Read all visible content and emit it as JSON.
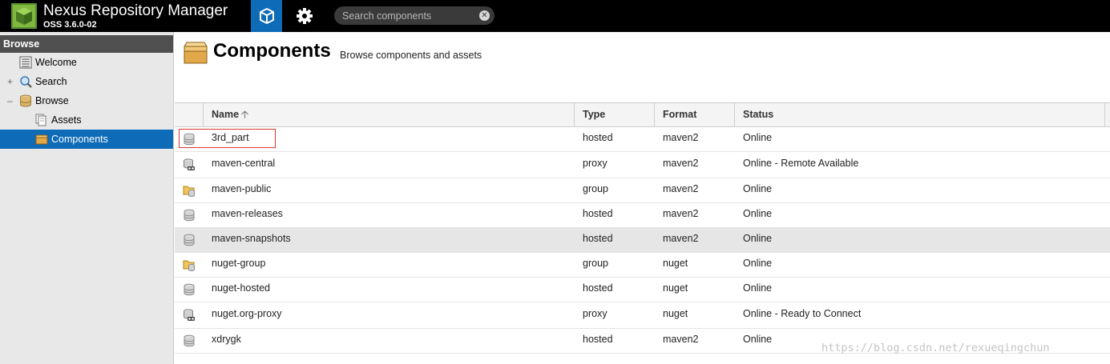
{
  "app": {
    "title": "Nexus Repository Manager",
    "version": "OSS 3.6.0-02"
  },
  "header": {
    "search_placeholder": "Search components",
    "nav_browse_icon": "cube-icon",
    "nav_admin_icon": "gear-icon",
    "clear_symbol": "✕"
  },
  "sidebar": {
    "title": "Browse",
    "items": [
      {
        "label": "Welcome",
        "icon": "welcome-icon",
        "toggle": ""
      },
      {
        "label": "Search",
        "icon": "magnifier-icon",
        "toggle": "+"
      },
      {
        "label": "Browse",
        "icon": "database-icon",
        "toggle": "–"
      },
      {
        "label": "Assets",
        "icon": "assets-icon",
        "toggle": ""
      },
      {
        "label": "Components",
        "icon": "box-icon",
        "toggle": ""
      }
    ]
  },
  "main": {
    "title": "Components",
    "subtitle": "Browse components and assets"
  },
  "grid": {
    "columns": {
      "name": "Name",
      "sort_arrow": "🡡",
      "type": "Type",
      "format": "Format",
      "status": "Status"
    },
    "rows": [
      {
        "name": "3rd_part",
        "type": "hosted",
        "format": "maven2",
        "status": "Online",
        "icon": "database-icon"
      },
      {
        "name": "maven-central",
        "type": "proxy",
        "format": "maven2",
        "status": "Online - Remote Available",
        "icon": "proxy-database-icon"
      },
      {
        "name": "maven-public",
        "type": "group",
        "format": "maven2",
        "status": "Online",
        "icon": "group-folder-icon"
      },
      {
        "name": "maven-releases",
        "type": "hosted",
        "format": "maven2",
        "status": "Online",
        "icon": "database-icon"
      },
      {
        "name": "maven-snapshots",
        "type": "hosted",
        "format": "maven2",
        "status": "Online",
        "icon": "database-icon"
      },
      {
        "name": "nuget-group",
        "type": "group",
        "format": "nuget",
        "status": "Online",
        "icon": "group-folder-icon"
      },
      {
        "name": "nuget-hosted",
        "type": "hosted",
        "format": "nuget",
        "status": "Online",
        "icon": "database-icon"
      },
      {
        "name": "nuget.org-proxy",
        "type": "proxy",
        "format": "nuget",
        "status": "Online - Ready to Connect",
        "icon": "proxy-database-icon"
      },
      {
        "name": "xdrygk",
        "type": "hosted",
        "format": "maven2",
        "status": "Online",
        "icon": "database-icon"
      }
    ]
  },
  "watermark": "https://blog.csdn.net/rexueqingchun"
}
